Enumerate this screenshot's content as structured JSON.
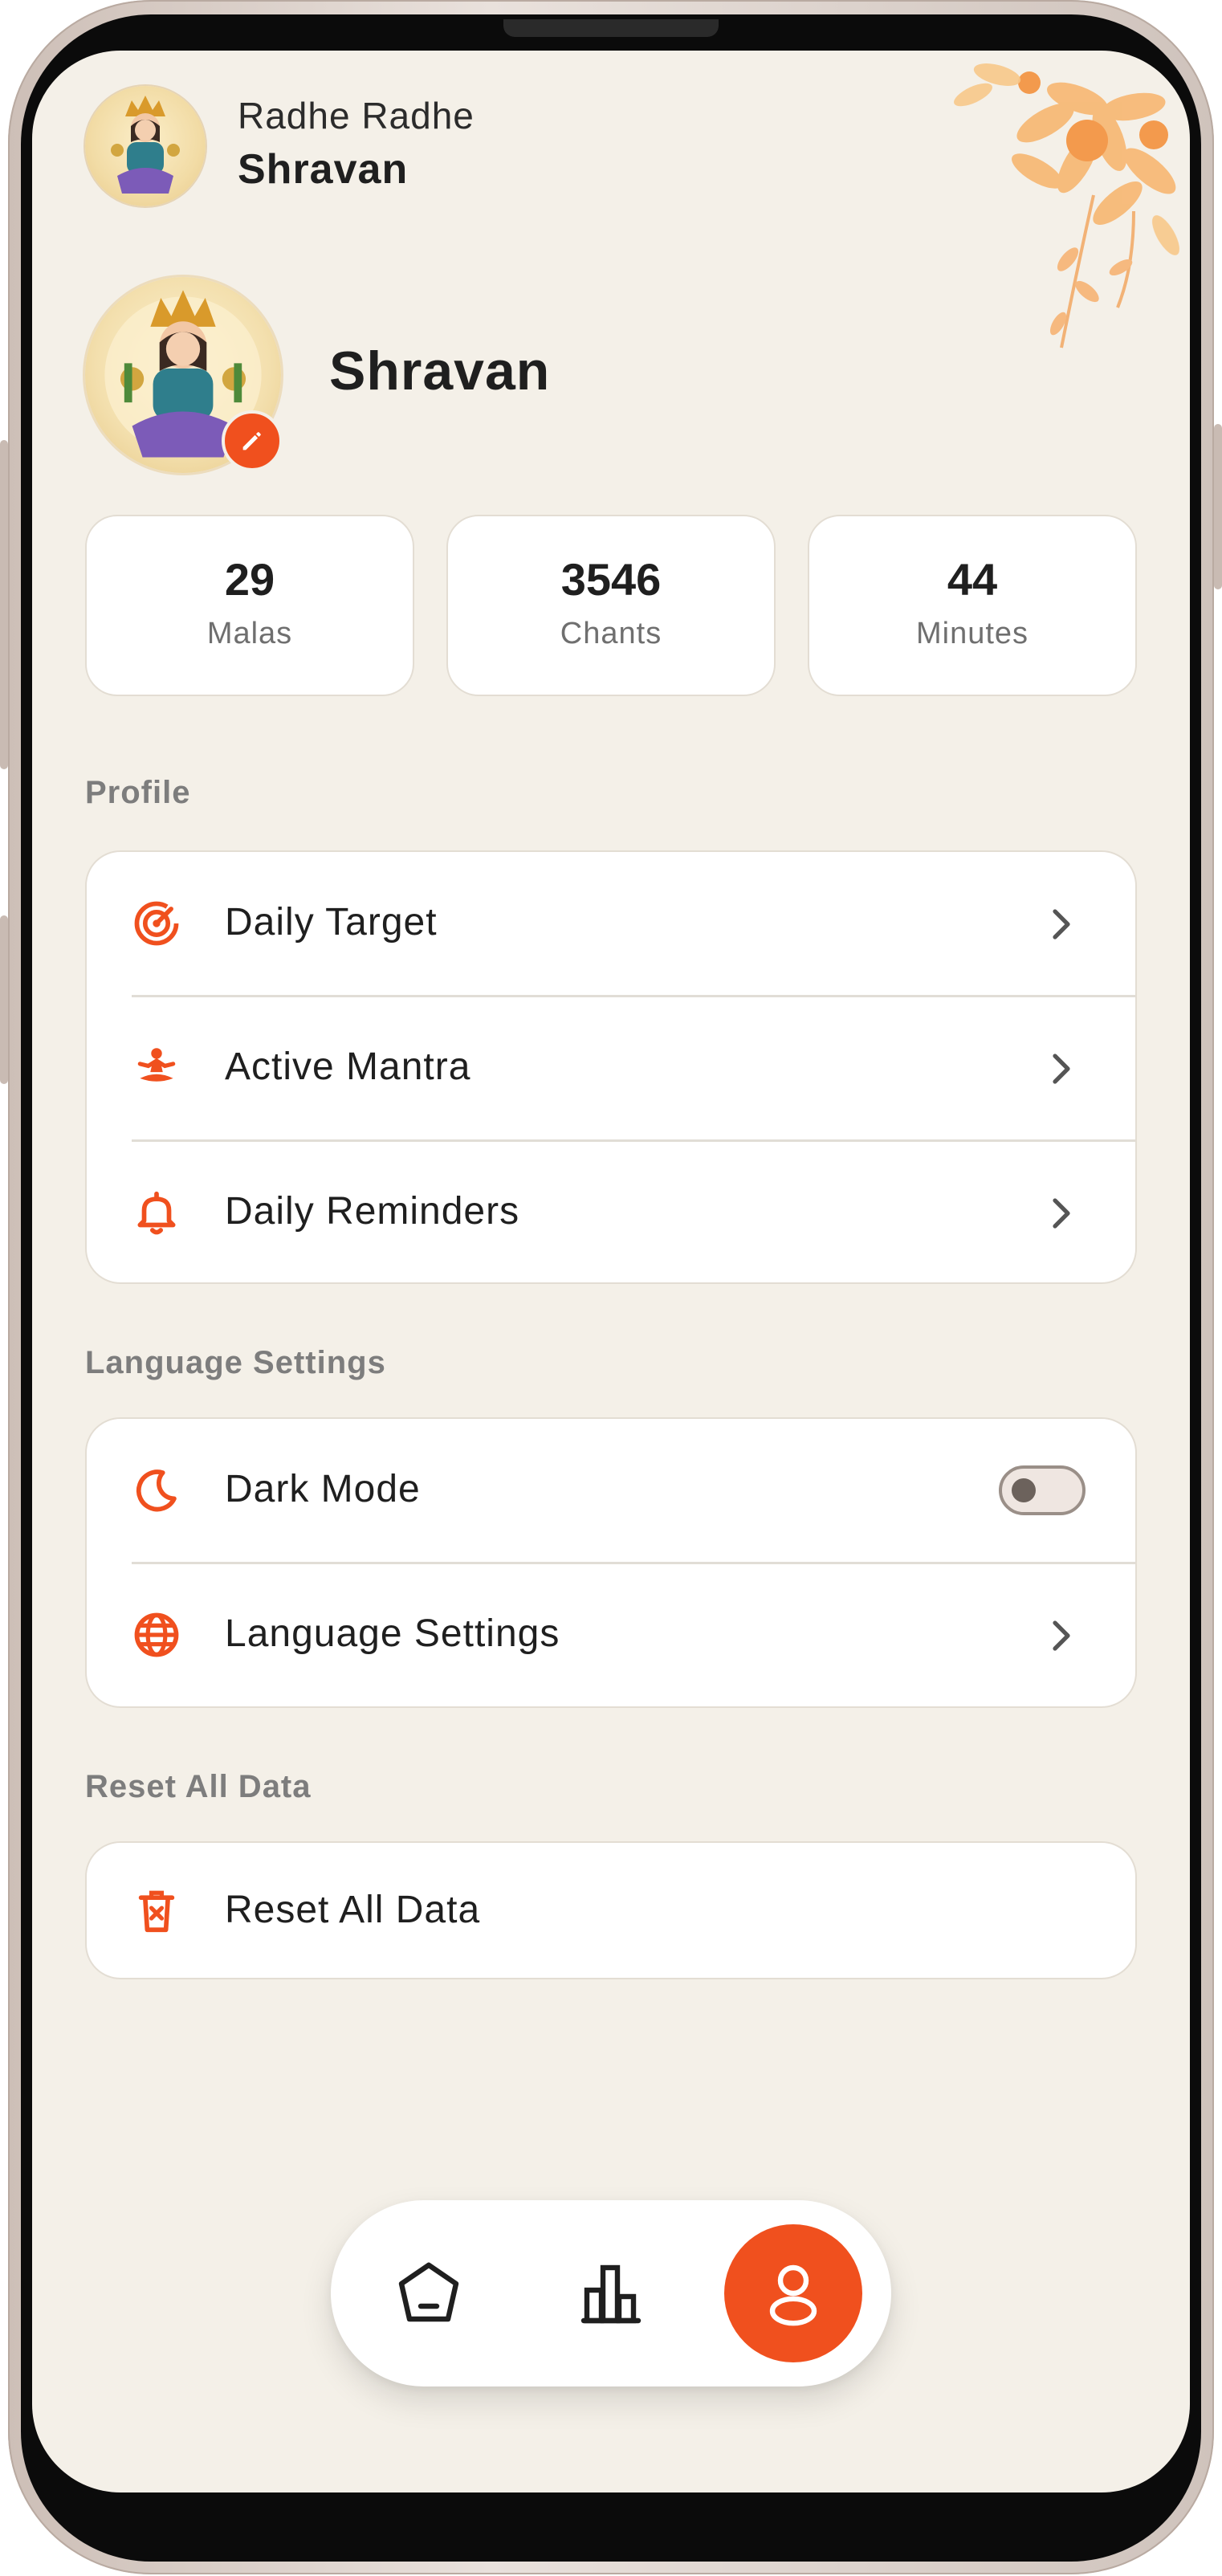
{
  "colors": {
    "accent": "#f0501e",
    "background": "#f4f0e8",
    "card": "#ffffff",
    "text_primary": "#1f1f1f",
    "text_secondary": "#6f6f6f",
    "section_title": "#7d7d7d"
  },
  "header": {
    "greeting": "Radhe Radhe",
    "name": "Shravan",
    "avatar_icon": "deity-avatar"
  },
  "profile": {
    "name": "Shravan",
    "avatar_icon": "deity-avatar",
    "edit_icon": "pencil-icon"
  },
  "stats": [
    {
      "value": "29",
      "label": "Malas"
    },
    {
      "value": "3546",
      "label": "Chants"
    },
    {
      "value": "44",
      "label": "Minutes"
    }
  ],
  "sections": {
    "profile": {
      "title": "Profile",
      "items": [
        {
          "label": "Daily Target",
          "icon": "target-icon"
        },
        {
          "label": "Active Mantra",
          "icon": "meditation-icon"
        },
        {
          "label": "Daily Reminders",
          "icon": "bell-icon"
        }
      ]
    },
    "language": {
      "title": "Language Settings",
      "items": [
        {
          "label": "Dark Mode",
          "icon": "moon-icon",
          "toggle": false
        },
        {
          "label": "Language Settings",
          "icon": "globe-icon"
        }
      ]
    },
    "reset": {
      "title": "Reset All Data",
      "items": [
        {
          "label": "Reset All Data",
          "icon": "trash-icon"
        }
      ]
    }
  },
  "bottom_nav": {
    "items": [
      {
        "icon": "home-icon",
        "active": false
      },
      {
        "icon": "bar-chart-icon",
        "active": false
      },
      {
        "icon": "profile-icon",
        "active": true
      }
    ]
  }
}
